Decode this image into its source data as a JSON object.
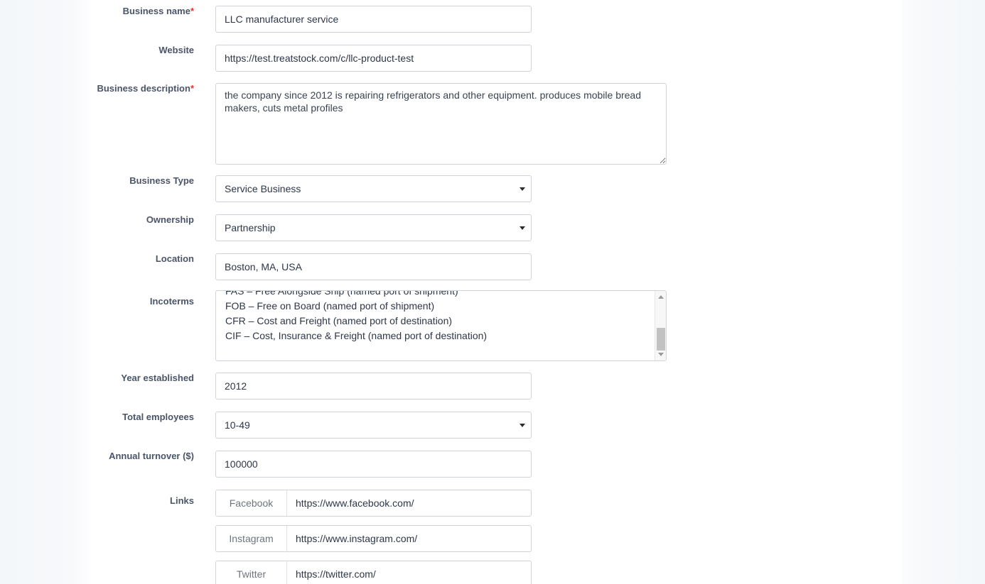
{
  "form": {
    "fields": {
      "business_name": {
        "label": "Business name",
        "required_mark": "*",
        "value": "LLC manufacturer service"
      },
      "website": {
        "label": "Website",
        "value": "https://test.treatstock.com/c/llc-product-test"
      },
      "business_description": {
        "label": "Business description",
        "required_mark": "*",
        "value": "the company since 2012 is repairing refrigerators and other equipment. produces mobile bread makers, cuts metal profiles"
      },
      "business_type": {
        "label": "Business Type",
        "value": "Service Business"
      },
      "ownership": {
        "label": "Ownership",
        "value": "Partnership"
      },
      "location": {
        "label": "Location",
        "value": "Boston, MA, USA"
      },
      "incoterms": {
        "label": "Incoterms",
        "options": [
          "FAS – Free Alongside Ship (named port of shipment)",
          "FOB – Free on Board (named port of shipment)",
          "CFR – Cost and Freight (named port of destination)",
          "CIF – Cost, Insurance & Freight (named port of destination)"
        ]
      },
      "year_established": {
        "label": "Year established",
        "value": "2012"
      },
      "total_employees": {
        "label": "Total employees",
        "value": "10-49"
      },
      "annual_turnover": {
        "label": "Annual turnover ($)",
        "value": "100000"
      },
      "links": {
        "label": "Links",
        "rows": [
          {
            "prefix": "Facebook",
            "value": "https://www.facebook.com/"
          },
          {
            "prefix": "Instagram",
            "value": "https://www.instagram.com/"
          },
          {
            "prefix": "Twitter",
            "value": "https://twitter.com/"
          }
        ]
      }
    }
  },
  "colors": {
    "label": "#4a5568",
    "required": "#e3342f",
    "input_border": "#ced4da",
    "input_text": "#2d3748",
    "prefix_text": "#6c757d",
    "page_bg": "#f7f9fb",
    "content_bg": "#ffffff"
  }
}
